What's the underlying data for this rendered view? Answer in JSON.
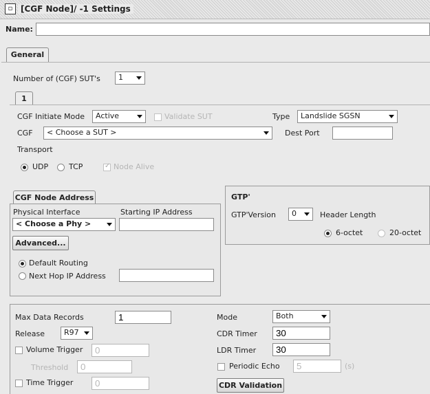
{
  "window": {
    "title": "[CGF Node]/ -1 Settings"
  },
  "name_field": {
    "label": "Name:",
    "value": ""
  },
  "tabs": {
    "general": "General",
    "sut_tab": "1"
  },
  "num_suts": {
    "label": "Number of (CGF) SUT's",
    "value": "1"
  },
  "sut": {
    "initiate_mode_label": "CGF Initiate Mode",
    "initiate_mode_value": "Active",
    "validate_sut_label": "Validate SUT",
    "type_label": "Type",
    "type_value": "Landslide SGSN",
    "cgf_label": "CGF",
    "cgf_value": "< Choose a SUT >",
    "dest_port_label": "Dest Port",
    "dest_port_value": "",
    "transport_label": "Transport",
    "udp_label": "UDP",
    "tcp_label": "TCP",
    "node_alive_label": "Node Alive"
  },
  "node_address": {
    "tab_label": "CGF Node Address",
    "physical_interface_label": "Physical Interface",
    "physical_interface_value": "< Choose a Phy >",
    "starting_ip_label": "Starting IP Address",
    "starting_ip_value": "",
    "advanced_label": "Advanced...",
    "default_routing_label": "Default Routing",
    "next_hop_label": "Next Hop IP Address",
    "next_hop_value": ""
  },
  "gtp": {
    "title": "GTP'",
    "version_label": "GTP'Version",
    "version_value": "0",
    "header_length_label": "Header Length",
    "six_octet_label": "6-octet",
    "twenty_octet_label": "20-octet"
  },
  "records": {
    "max_data_records_label": "Max Data Records",
    "max_data_records_value": "1",
    "release_label": "Release",
    "release_value": "R97",
    "volume_trigger_label": "Volume Trigger",
    "volume_trigger_value": "0",
    "threshold_label": "Threshold",
    "threshold_value": "0",
    "time_trigger_label": "Time Trigger",
    "time_trigger_value": "0",
    "mode_label": "Mode",
    "mode_value": "Both",
    "cdr_timer_label": "CDR Timer",
    "cdr_timer_value": "30",
    "ldr_timer_label": "LDR Timer",
    "ldr_timer_value": "30",
    "periodic_echo_label": "Periodic Echo",
    "periodic_echo_value": "5",
    "periodic_echo_unit": "(s)",
    "cdr_validation_label": "CDR Validation"
  }
}
